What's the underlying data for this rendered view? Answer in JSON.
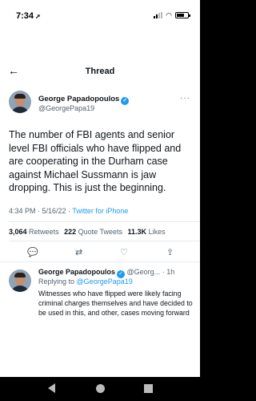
{
  "status_bar": {
    "time": "7:34",
    "location_arrow": "➚"
  },
  "nav": {
    "back_glyph": "←",
    "title": "Thread"
  },
  "main_tweet": {
    "author_name": "George Papadopoulos",
    "author_handle": "@GeorgePapa19",
    "verified_glyph": "✓",
    "more_glyph": "···",
    "text": "The number of FBI agents and senior level FBI officials who have flipped and are cooperating in the Durham case against Michael Sussmann is jaw dropping. This is just the beginning.",
    "time": "4:34 PM",
    "date": "5/16/22",
    "source": "Twitter for iPhone",
    "retweets": "3,064",
    "retweets_label": "Retweets",
    "quote_tweets": "222",
    "quote_tweets_label": "Quote Tweets",
    "likes": "11.3K",
    "likes_label": "Likes"
  },
  "actions": {
    "reply_glyph": "💬",
    "retweet_glyph": "⇄",
    "like_glyph": "♡",
    "share_glyph": "⇪"
  },
  "reply_tweet": {
    "author_name": "George Papadopoulos",
    "author_handle": "@Georg...",
    "age": "1h",
    "replying_prefix": "Replying to",
    "replying_to": "@GeorgePapa19",
    "text": "Witnesses who have flipped were likely facing criminal charges themselves and have decided to be used in this, and other, cases moving forward"
  }
}
